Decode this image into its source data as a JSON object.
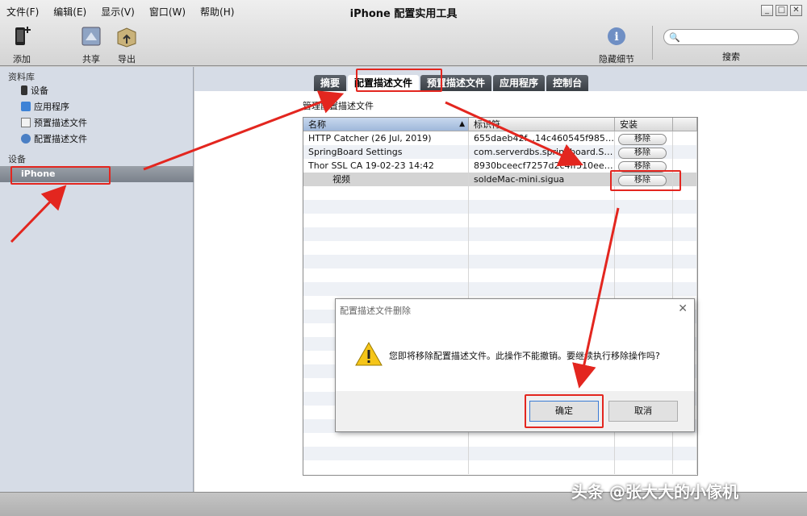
{
  "menu": [
    "文件(F)",
    "编辑(E)",
    "显示(V)",
    "窗口(W)",
    "帮助(H)"
  ],
  "app_title": "iPhone 配置实用工具",
  "toolbar": {
    "add": "添加",
    "share": "共享",
    "export": "导出",
    "hide_details": "隐藏细节",
    "search_label": "搜索"
  },
  "sidebar": {
    "library_heading": "资料库",
    "library_items": [
      "设备",
      "应用程序",
      "预置描述文件",
      "配置描述文件"
    ],
    "devices_heading": "设备",
    "device_selected": "iPhone"
  },
  "tabs": [
    "摘要",
    "配置描述文件",
    "预置描述文件",
    "应用程序",
    "控制台"
  ],
  "active_tab_index": 1,
  "section_title": "管理配置描述文件",
  "table": {
    "headers": [
      "名称",
      "标识符",
      "安装"
    ],
    "rows": [
      {
        "name": "HTTP Catcher (26 Jul, 2019)",
        "id": "655daeb42f...14c460545f9851...",
        "action": "移除"
      },
      {
        "name": "SpringBoard Settings",
        "id": "com.serverdbs.springboard.SB...",
        "action": "移除"
      },
      {
        "name": "Thor SSL CA 19-02-23 14:42",
        "id": "8930bceecf7257d2c4ff510eeb...",
        "action": "移除"
      },
      {
        "name": "视频",
        "id": "soldeMac-mini.sigua",
        "action": "移除",
        "selected": true
      }
    ]
  },
  "dialog": {
    "title": "配置描述文件删除",
    "message": "您即将移除配置描述文件。此操作不能撤销。要继续执行移除操作吗?",
    "ok": "确定",
    "cancel": "取消"
  },
  "watermark": "头条 @张大大的小傢机",
  "colors": {
    "annotation_red": "#e3261f",
    "tab_dark": "#3a3f45",
    "sidebar_bg": "#d6dce6"
  }
}
